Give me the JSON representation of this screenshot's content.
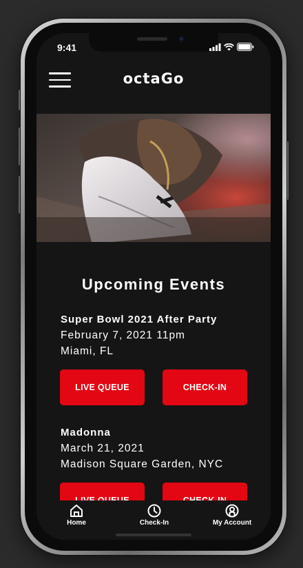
{
  "status": {
    "time": "9:41"
  },
  "header": {
    "logo_text": "octaGo"
  },
  "hero": {
    "alt": "Close-up of a white sneaker being tied"
  },
  "events_section": {
    "title": "Upcoming Events"
  },
  "events": [
    {
      "name": "Super Bowl 2021 After Party",
      "date": "February 7, 2021 11pm",
      "location": "Miami, FL",
      "live_queue_label": "LIVE QUEUE",
      "checkin_label": "CHECK-IN"
    },
    {
      "name": "Madonna",
      "date": "March 21, 2021",
      "location": "Madison Square Garden, NYC",
      "live_queue_label": "LIVE QUEUE",
      "checkin_label": "CHECK-IN"
    }
  ],
  "tabbar": {
    "items": [
      {
        "label": "Home",
        "icon": "home-icon"
      },
      {
        "label": "Check-In",
        "icon": "clock-icon"
      },
      {
        "label": "My Account",
        "icon": "account-icon"
      }
    ]
  },
  "colors": {
    "accent": "#e30613",
    "background": "#151515",
    "text": "#ffffff"
  }
}
